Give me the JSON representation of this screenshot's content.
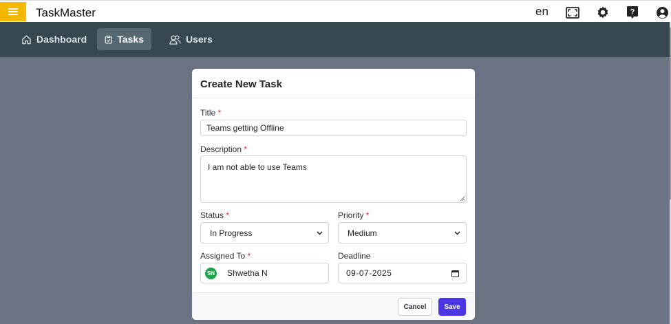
{
  "app": {
    "title": "TaskMaster",
    "language": "en"
  },
  "header_icons": [
    "menu-icon",
    "fullscreen-icon",
    "gear-icon",
    "help-icon",
    "account-icon"
  ],
  "nav": {
    "items": [
      {
        "label": "Dashboard",
        "icon": "home-icon",
        "active": false
      },
      {
        "label": "Tasks",
        "icon": "clipboard-check-icon",
        "active": true
      },
      {
        "label": "Users",
        "icon": "users-icon",
        "active": false
      }
    ]
  },
  "modal": {
    "title": "Create New Task",
    "required_mark": "*",
    "fields": {
      "title": {
        "label": "Title",
        "value": "Teams getting Offline"
      },
      "description": {
        "label": "Description",
        "value": "I am not able to use Teams"
      },
      "status": {
        "label": "Status",
        "value": "In Progress"
      },
      "priority": {
        "label": "Priority",
        "value": "Medium"
      },
      "assigned_to": {
        "label": "Assigned To",
        "initials": "SN",
        "value": "Shwetha N"
      },
      "deadline": {
        "label": "Deadline",
        "value": "09-07-2025"
      }
    },
    "buttons": {
      "cancel": "Cancel",
      "save": "Save"
    }
  },
  "colors": {
    "menu_button": "#f5b800",
    "navbar": "#374850",
    "overlay": "#6b7281",
    "save": "#4b36e6",
    "avatar": "#1ea34a",
    "required": "#e0243a"
  }
}
